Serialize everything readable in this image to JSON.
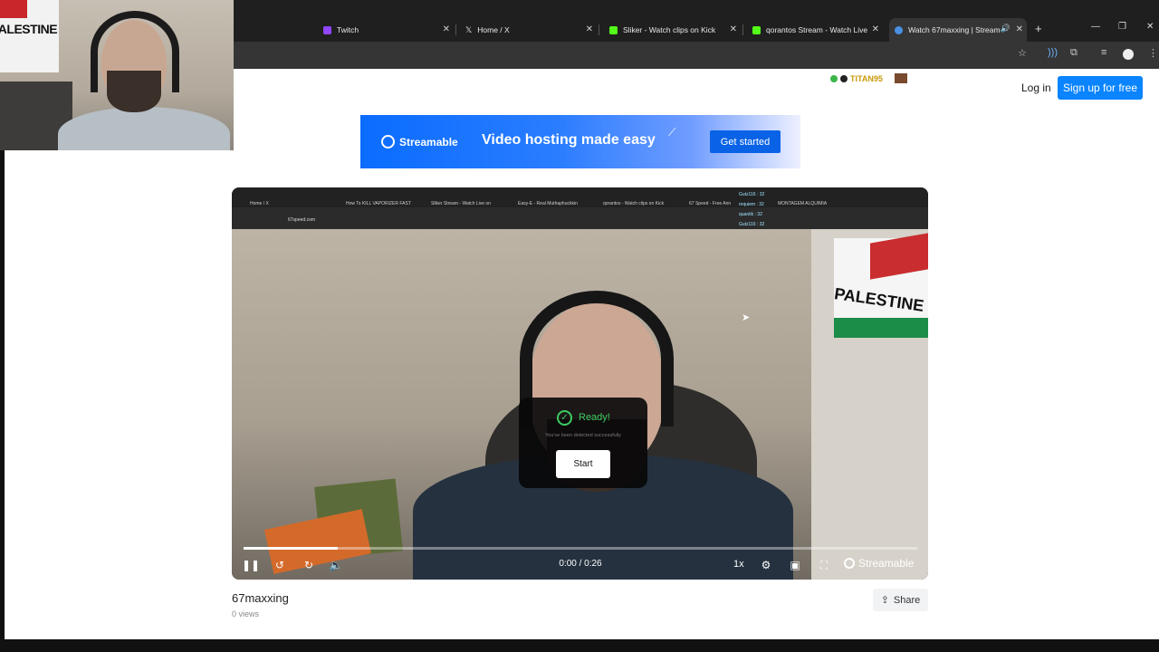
{
  "browser": {
    "tabs": [
      {
        "label": "Twitch",
        "color": "#9146ff"
      },
      {
        "label": "Home / X",
        "color": "#ffffff"
      },
      {
        "label": "Sliker - Watch clips on Kick",
        "color": "#53fc18"
      },
      {
        "label": "qorantos Stream - Watch Live o",
        "color": "#53fc18"
      },
      {
        "label": "Watch 67maxxing | Stream",
        "color": "#4a90e2",
        "active": true
      }
    ],
    "new_tab": "+",
    "min": "—",
    "restore": "❐",
    "close": "✕"
  },
  "webcam": {
    "flag_text": "PALESTINE"
  },
  "header": {
    "badge": "TITAN95",
    "login_label": "Log in",
    "signup_label": "Sign up for free"
  },
  "banner": {
    "brand": "Streamable",
    "headline": "Video hosting made easy",
    "cta": "Get started"
  },
  "player": {
    "inner_tabs": [
      "Home / X",
      "How To KILL VAPORIZER FAST",
      "Sliker Stream - Watch Live on",
      "Easy-E - Real Muthaphuckkin",
      "qorantos - Watch clips on Kick",
      "67 Speed - Free Ann",
      "MONTAGEM ALQUIMIA"
    ],
    "inner_url": "67speed.com",
    "inner_chat": [
      "Gutz116 : 32",
      "requiem : 32",
      "quantik : 32",
      "Gutz116 : 32"
    ],
    "scene_flag_text": "PALESTINE",
    "overlay": {
      "ready": "Ready!",
      "sub": "You've been detected successfully",
      "start": "Start"
    },
    "progress": 0.14,
    "time": "0:00 / 0:26",
    "speed": "1x",
    "brand": "Streamable"
  },
  "video": {
    "title": "67maxxing",
    "views": "0 views",
    "share": "Share"
  }
}
